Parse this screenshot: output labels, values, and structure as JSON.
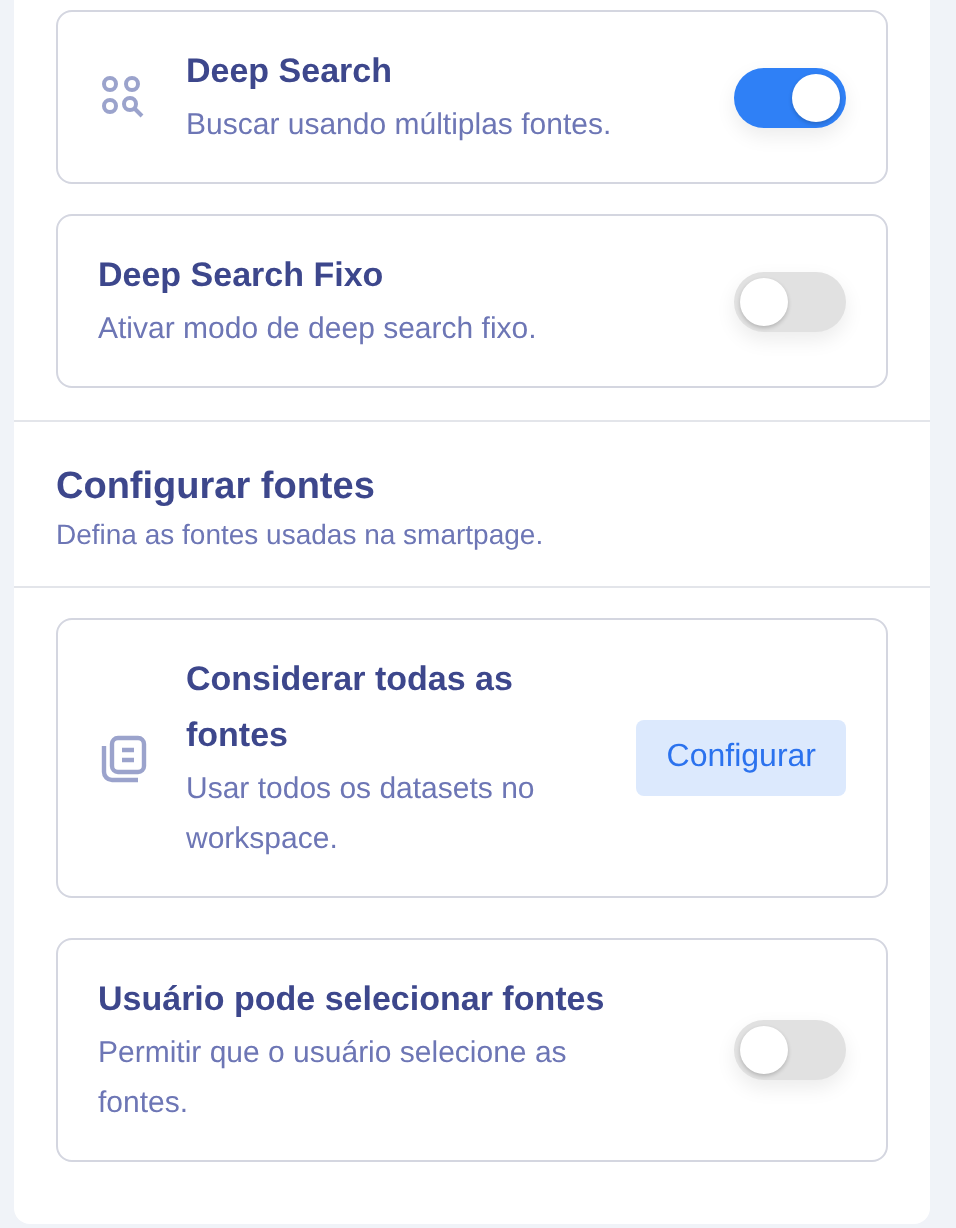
{
  "cards_top": [
    {
      "kind": "toggle",
      "title": "Deep Search",
      "description": "Buscar usando múltiplas fontes.",
      "on": true
    },
    {
      "kind": "toggle",
      "title": "Deep Search Fixo",
      "description": "Ativar modo de deep search fixo.",
      "on": false
    }
  ],
  "section": {
    "title": "Configurar fontes",
    "subtitle": "Defina as fontes usadas na smartpage."
  },
  "cards_bottom": [
    {
      "kind": "button",
      "title": "Considerar todas as fontes",
      "description": "Usar todos os datasets no workspace.",
      "button": "Configurar"
    },
    {
      "kind": "toggle",
      "title": "Usuário pode selecionar fontes",
      "description": "Permitir que o usuário selecione as fontes.",
      "on": false
    }
  ]
}
